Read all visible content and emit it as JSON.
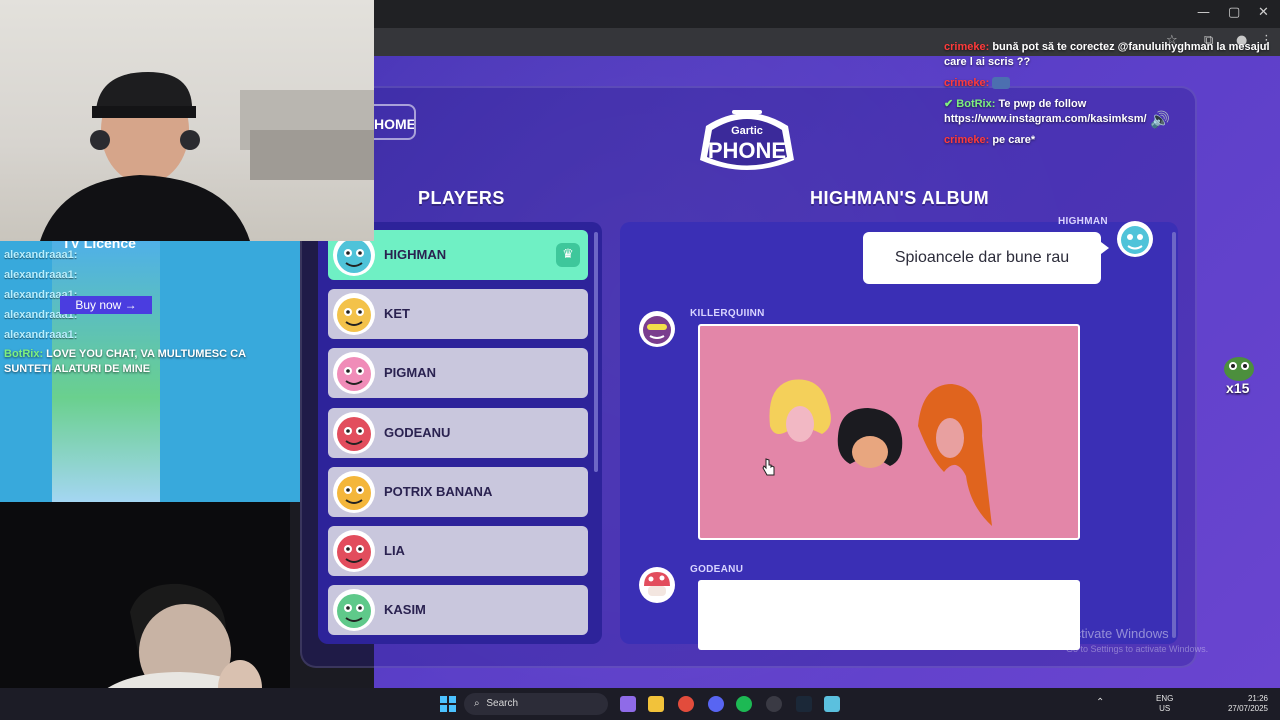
{
  "browser": {
    "window_controls": [
      "—",
      "▢",
      "✕"
    ]
  },
  "game": {
    "home_button_label": "HOME",
    "logo_top": "Gartic",
    "logo_bottom": "PHONE",
    "players_title": "PLAYERS",
    "album_title": "HIGHMAN'S ALBUM",
    "players": [
      {
        "name": "HIGHMAN",
        "host": true,
        "avatar_color": "#4fc3d9"
      },
      {
        "name": "KET",
        "host": false,
        "avatar_color": "#f3c24a"
      },
      {
        "name": "PIGMAN",
        "host": false,
        "avatar_color": "#f08cb8"
      },
      {
        "name": "GODEANU",
        "host": false,
        "avatar_color": "#e24d5d"
      },
      {
        "name": "POTRIX BANANA",
        "host": false,
        "avatar_color": "#f4b63a"
      },
      {
        "name": "LIA",
        "host": false,
        "avatar_color": "#e24d5d"
      },
      {
        "name": "KASIM",
        "host": false,
        "avatar_color": "#5fc98a"
      }
    ],
    "album": {
      "entry1_author": "HIGHMAN",
      "entry1_text": "Spioancele dar bune rau",
      "entry2_author": "KILLERQUIINN",
      "entry3_author": "GODEANU"
    },
    "activate_windows_title": "Activate Windows",
    "activate_windows_sub": "Go to Settings to activate Windows."
  },
  "chat_right": [
    {
      "user": "crimeke:",
      "text": "bună pot să te corectez @fanuluihyghman la mesajul care l ai scris ??",
      "bot": false
    },
    {
      "user": "crimeke:",
      "text": "",
      "bot": false
    },
    {
      "user": "BotRix:",
      "text": "Te pwp de follow https://www.instagram.com/kasimksm/",
      "bot": true
    },
    {
      "user": "crimeke:",
      "text": "pe care*",
      "bot": false
    }
  ],
  "alerts": {
    "tv_licence": "TV Licence",
    "rows": [
      "alexandraaa1:",
      "alexandraaa1:",
      "alexandraaa1:",
      "alexandraaa1:",
      "alexandraaa1:"
    ],
    "buy_now": "Buy now →",
    "botrix_user": "BotRix:",
    "botrix_msg": "LOVE YOU CHAT, VA MULTUMESC CA SUNTETI ALATURI DE MINE"
  },
  "emote_counter": "x15",
  "taskbar": {
    "search": "Search",
    "lang_top": "ENG",
    "lang_bottom": "US",
    "time": "21:26",
    "date": "27/07/2025"
  }
}
